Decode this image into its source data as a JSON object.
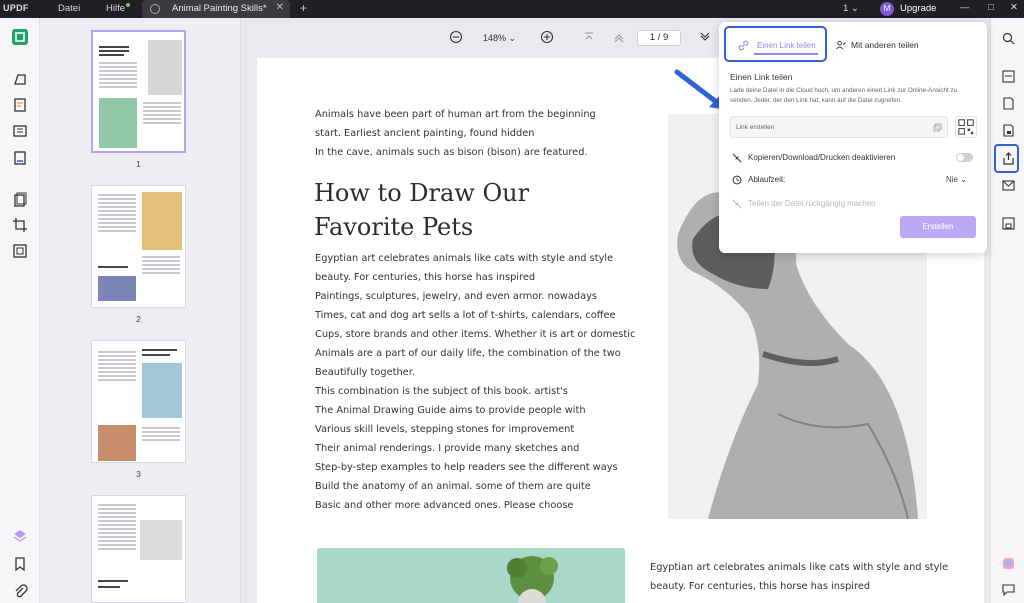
{
  "titlebar": {
    "logo": "UPDF",
    "menu_file": "Datei",
    "menu_help": "Hilfe",
    "tab_title": "Animal Painting Skills*",
    "tab_close": "✕",
    "new_tab": "+",
    "doc_count": "1",
    "avatar_letter": "M",
    "upgrade_label": "Upgrade",
    "minimize": "—",
    "maximize": "□",
    "close": "✕"
  },
  "toolbar": {
    "zoom": "148%",
    "page_indicator": "1  /  9"
  },
  "thumbnails": {
    "pages": [
      "1",
      "2",
      "3"
    ]
  },
  "document": {
    "intro": [
      "Animals have been part of human art from the beginning",
      "start. Earliest ancient painting, found hidden",
      "In the cave, animals such as bison (bison) are featured."
    ],
    "heading_line1": "How to Draw Our",
    "heading_line2": "Favorite Pets",
    "body": [
      "Egyptian art celebrates animals like cats with style and style",
      "beauty. For centuries, this horse has inspired",
      "Paintings, sculptures, jewelry, and even armor. nowadays",
      "Times, cat and dog art sells a lot of t-shirts, calendars, coffee",
      "Cups, store brands and other items. Whether it is art or domestic",
      "Animals are a part of our daily life, the combination of the two",
      "Beautifully together.",
      "This combination is the subject of this book. artist's",
      "The Animal Drawing Guide aims to provide people with",
      "Various skill levels, stepping stones for improvement",
      "Their animal renderings. I provide many sketches and",
      "Step-by-step examples to help readers see the different ways",
      "Build the anatomy of an animal. some of them are quite",
      "Basic and other more advanced ones. Please choose"
    ],
    "bottom_right": [
      "Egyptian art celebrates animals like cats with style and style",
      "beauty. For centuries, this horse has inspired"
    ]
  },
  "share_popover": {
    "tab_link": "Einen Link teilen",
    "tab_others": "Mit anderen teilen",
    "section_title": "Einen Link teilen",
    "description": "Lade deine Datei in die Cloud hoch, um anderen einen Link zur Online-Ansicht zu senden. Jeder, der den Link hat, kann auf die Datei zugreifen.",
    "link_placeholder": "Link erstellen",
    "disable_label": "Kopieren/Download/Drucken deaktivieren",
    "expiry_label": "Ablaufzeit:",
    "expiry_value": "Nie",
    "revoke_label": "Teilen der Datei rückgängig machen",
    "create_button": "Erstellen"
  },
  "colors": {
    "accent_purple": "#9b82f0",
    "highlight_blue": "#2f62d6",
    "titlebar_bg": "#1f1f24"
  }
}
